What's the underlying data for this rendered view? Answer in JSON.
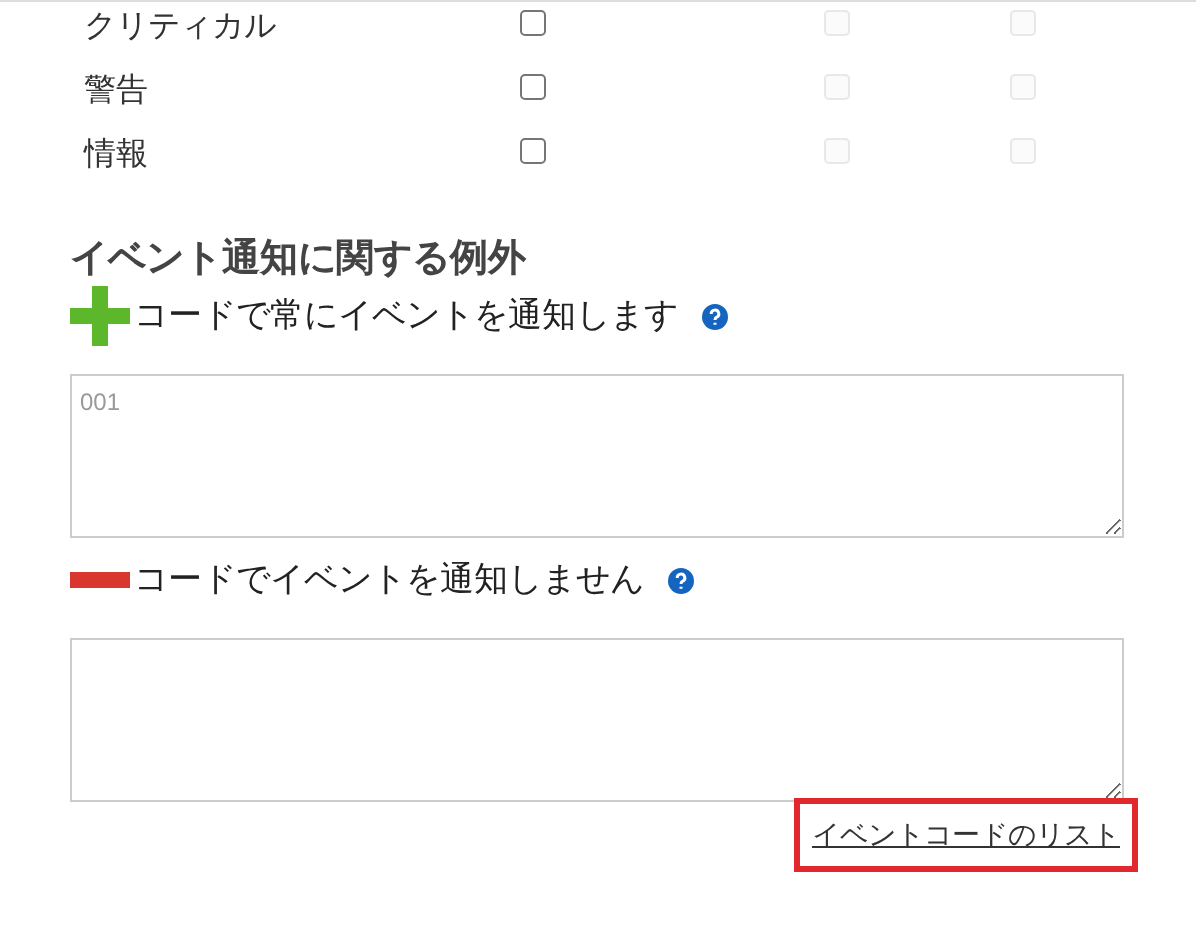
{
  "severities": [
    {
      "label": "クリティカル",
      "checks": [
        {
          "checked": false,
          "disabled": false
        },
        {
          "checked": false,
          "disabled": true
        },
        {
          "checked": false,
          "disabled": true
        }
      ]
    },
    {
      "label": "警告",
      "checks": [
        {
          "checked": false,
          "disabled": false
        },
        {
          "checked": false,
          "disabled": true
        },
        {
          "checked": false,
          "disabled": true
        }
      ]
    },
    {
      "label": "情報",
      "checks": [
        {
          "checked": false,
          "disabled": false
        },
        {
          "checked": false,
          "disabled": true
        },
        {
          "checked": false,
          "disabled": true
        }
      ]
    }
  ],
  "exceptions": {
    "title": "イベント通知に関する例外",
    "rules": [
      {
        "kind": "include",
        "label": "コードで常にイベントを通知します",
        "placeholder": "001"
      },
      {
        "kind": "exclude",
        "label": "コードでイベントを通知しません"
      }
    ]
  },
  "link": {
    "text": "イベントコードのリスト",
    "highlighted": true
  }
}
